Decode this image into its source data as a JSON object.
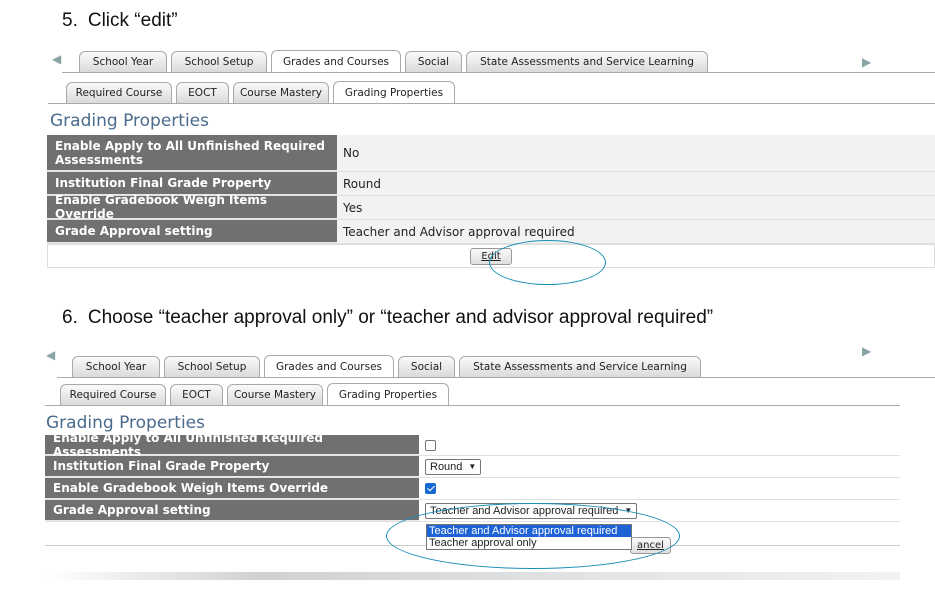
{
  "step5": {
    "number": "5.",
    "text": "Click “edit”"
  },
  "step6": {
    "number": "6.",
    "text": "Choose “teacher approval only” or “teacher and advisor approval required”"
  },
  "tabs_top": [
    "School Year",
    "School Setup",
    "Grades and Courses",
    "Social",
    "State Assessments and Service Learning"
  ],
  "subtabs": [
    "Required Course",
    "EOCT",
    "Course Mastery",
    "Grading Properties"
  ],
  "section_title": "Grading Properties",
  "panel1": {
    "rows": [
      {
        "label": "Enable Apply to All Unfinished Required Assessments",
        "value": "No"
      },
      {
        "label": "Institution Final Grade Property",
        "value": "Round"
      },
      {
        "label": "Enable Gradebook Weigh Items Override",
        "value": "Yes"
      },
      {
        "label": "Grade Approval setting",
        "value": "Teacher and Advisor approval required"
      }
    ],
    "edit_button": "Edit"
  },
  "panel2": {
    "rows": [
      {
        "label": "Enable Apply to All Unfinished Required Assessments",
        "checked": false
      },
      {
        "label": "Institution Final Grade Property",
        "select_value": "Round"
      },
      {
        "label": "Enable Gradebook Weigh Items Override",
        "checked": true
      },
      {
        "label": "Grade Approval setting",
        "select_value": "Teacher and Advisor approval required"
      }
    ],
    "dropdown_options": [
      "Teacher and Advisor approval required",
      "Teacher approval only"
    ],
    "cancel_button_partial": "ancel"
  },
  "colors": {
    "header_bg": "#707070",
    "title": "#4a6b8e",
    "highlight": "#1a8fb8",
    "selected_option": "#1e63d6"
  }
}
